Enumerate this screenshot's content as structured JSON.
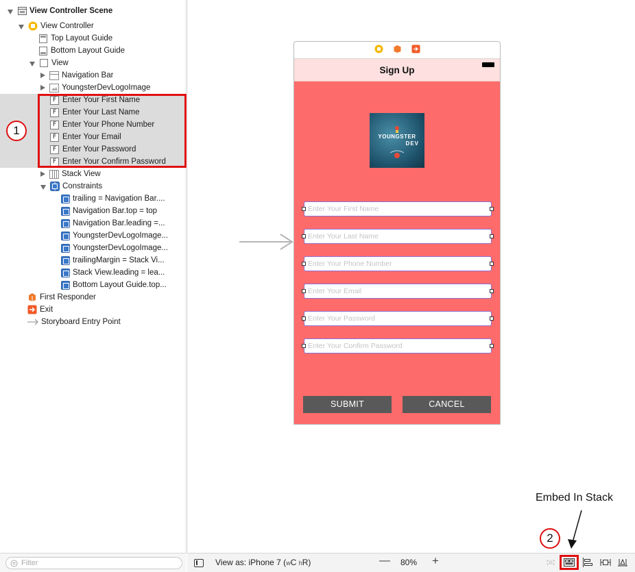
{
  "outline": {
    "scene_title": "View Controller Scene",
    "view_controller": "View Controller",
    "top_layout_guide": "Top Layout Guide",
    "bottom_layout_guide": "Bottom Layout Guide",
    "view": "View",
    "navigation_bar": "Navigation Bar",
    "logo_image": "YoungsterDevLogoImage",
    "text_fields": [
      "Enter Your First Name",
      "Enter Your Last Name",
      "Enter Your Phone Number",
      "Enter Your Email",
      "Enter Your Password",
      "Enter Your Confirm Password"
    ],
    "textfield_icon_letter": "F",
    "stack_view": "Stack View",
    "constraints_label": "Constraints",
    "constraints": [
      "trailing = Navigation Bar....",
      "Navigation Bar.top = top",
      "Navigation Bar.leading =...",
      "YoungsterDevLogoImage...",
      "YoungsterDevLogoImage...",
      "trailingMargin = Stack Vi...",
      "Stack View.leading = lea...",
      "Bottom Layout Guide.top..."
    ],
    "first_responder": "First Responder",
    "exit": "Exit",
    "entry_point": "Storyboard Entry Point",
    "filter_placeholder": "Filter"
  },
  "annotations": {
    "step1": "1",
    "step2": "2",
    "embed_label": "Embed In Stack"
  },
  "scene": {
    "nav_title": "Sign Up",
    "logo_line1": "YOUNGSTER",
    "logo_line2": "DEV",
    "fields": [
      "Enter Your First Name",
      "Enter Your Last Name",
      "Enter Your Phone Number",
      "Enter Your Email",
      "Enter Your Password",
      "Enter Your Confirm Password"
    ],
    "submit_label": "SUBMIT",
    "cancel_label": "CANCEL",
    "colors": {
      "background": "#fe6b6b",
      "navbar": "#fde0df",
      "button": "#595959"
    }
  },
  "toolbar": {
    "view_as_prefix": "View as: iPhone 7 (",
    "view_as_w": "w",
    "view_as_c": "C",
    "view_as_h": "h",
    "view_as_r": "R)",
    "zoom_minus": "—",
    "zoom": "80%",
    "zoom_plus": "+"
  }
}
